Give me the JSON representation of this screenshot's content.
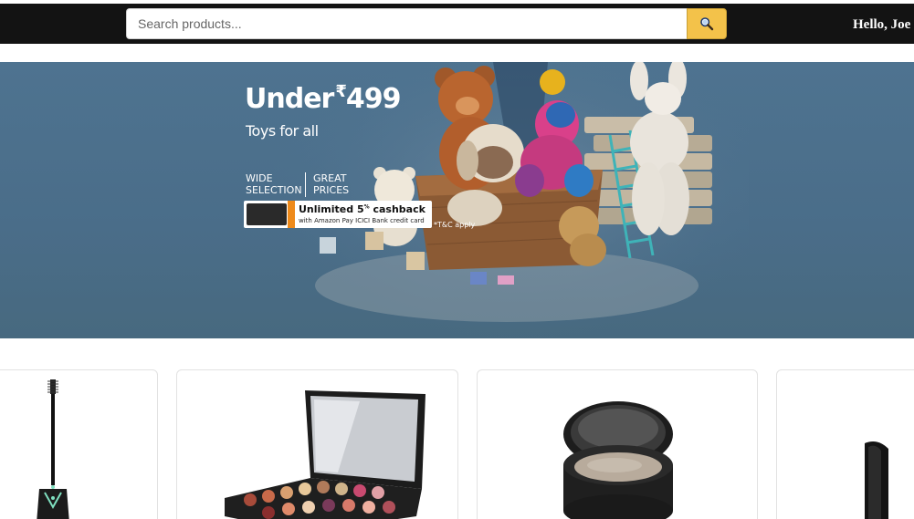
{
  "header": {
    "search": {
      "value": "",
      "placeholder": "Search products..."
    },
    "search_button_icon": "search-icon",
    "greeting": "Hello, Joe"
  },
  "banner": {
    "headline_prefix": "Under",
    "headline_currency": "₹",
    "headline_amount": "499",
    "subtitle": "Toys for all",
    "features": [
      {
        "line1": "WIDE",
        "line2": "SELECTION"
      },
      {
        "line1": "GREAT",
        "line2": "PRICES"
      }
    ],
    "offer_title": "Unlimited 5",
    "offer_title_sup": "%",
    "offer_title_rest": " cashback",
    "offer_subtitle": "with Amazon Pay ICICI Bank credit card",
    "terms": "*T&C apply"
  },
  "products": [
    {
      "image": "mascara-image"
    },
    {
      "image": "eyeshadow-palette-image"
    },
    {
      "image": "compact-powder-image"
    },
    {
      "image": "lipstick-image"
    }
  ],
  "colors": {
    "topbar": "#131313",
    "search_button": "#f3c24a",
    "banner": "#4e7390"
  }
}
